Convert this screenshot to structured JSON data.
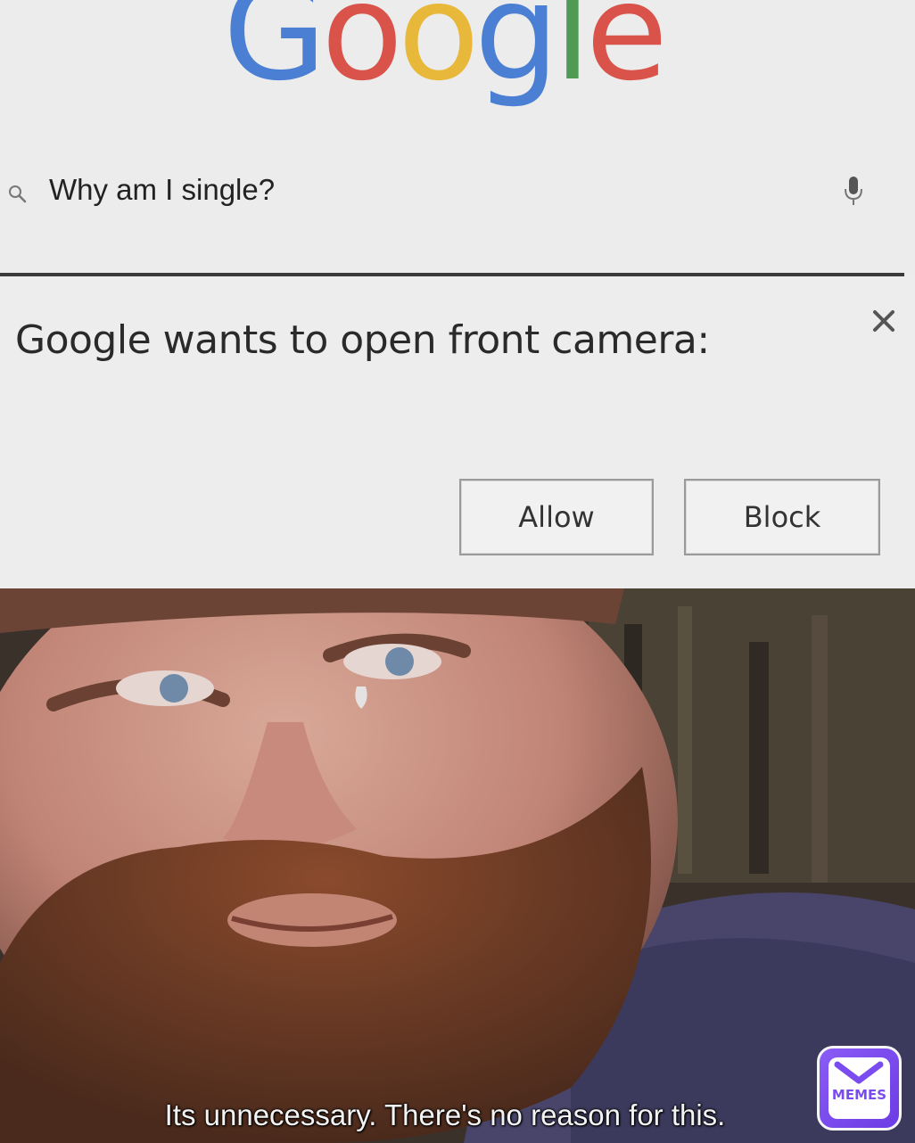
{
  "search": {
    "logo_letters": [
      {
        "ch": "G",
        "color": "#4a7fd4"
      },
      {
        "ch": "o",
        "color": "#d9534a"
      },
      {
        "ch": "o",
        "color": "#e8b83a"
      },
      {
        "ch": "g",
        "color": "#4a7fd4"
      },
      {
        "ch": "l",
        "color": "#4f9a55"
      },
      {
        "ch": "e",
        "color": "#d9534a"
      }
    ],
    "query": "Why am I single?",
    "search_icon": "search-icon",
    "mic_icon": "microphone-icon"
  },
  "dialog": {
    "message": "Google wants to open front camera:",
    "close_icon": "close-icon",
    "allow_label": "Allow",
    "block_label": "Block"
  },
  "photo": {
    "caption": "Its unnecessary. There's no reason for this."
  },
  "watermark": {
    "label": "MEMES",
    "color": "#7a4cf0"
  }
}
